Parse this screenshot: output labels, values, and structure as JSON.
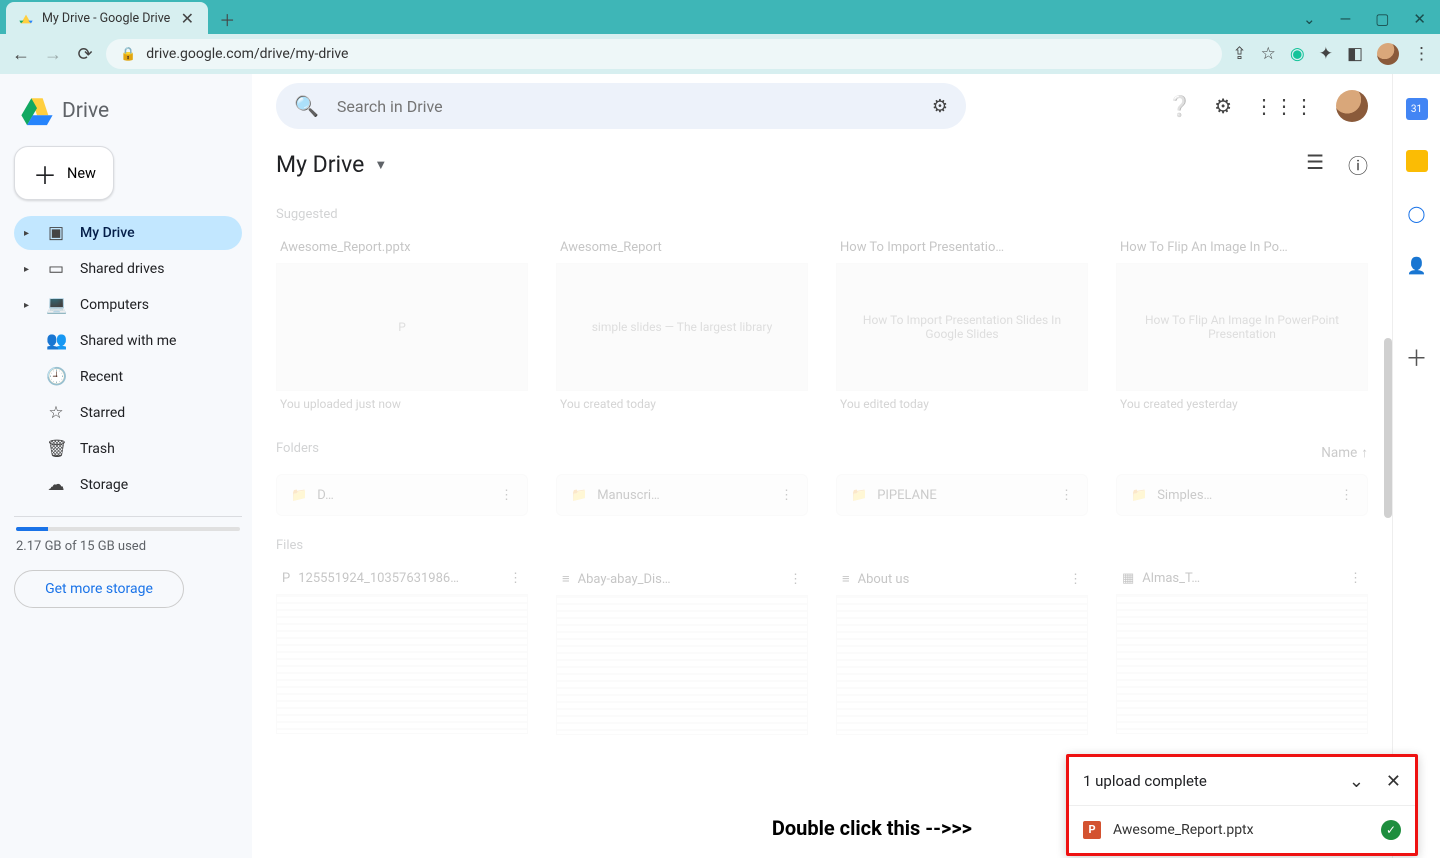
{
  "browser": {
    "tab_title": "My Drive - Google Drive",
    "url": "drive.google.com/drive/my-drive"
  },
  "product": {
    "name": "Drive"
  },
  "search": {
    "placeholder": "Search in Drive"
  },
  "new_button": "New",
  "sidebar": {
    "items": [
      {
        "label": "My Drive",
        "icon": "▣",
        "caret": true,
        "active": true
      },
      {
        "label": "Shared drives",
        "icon": "▭",
        "caret": true,
        "active": false
      },
      {
        "label": "Computers",
        "icon": "💻",
        "caret": true,
        "active": false
      },
      {
        "label": "Shared with me",
        "icon": "👥",
        "caret": false,
        "active": false
      },
      {
        "label": "Recent",
        "icon": "🕘",
        "caret": false,
        "active": false
      },
      {
        "label": "Starred",
        "icon": "☆",
        "caret": false,
        "active": false
      },
      {
        "label": "Trash",
        "icon": "🗑",
        "caret": false,
        "active": false
      },
      {
        "label": "Storage",
        "icon": "☁",
        "caret": false,
        "active": false
      }
    ],
    "storage_used": "2.17 GB of 15 GB used",
    "get_more": "Get more storage"
  },
  "main": {
    "heading": "My Drive",
    "suggested_label": "Suggested",
    "suggested": [
      {
        "title": "Awesome_Report.pptx",
        "thumb": "P",
        "sub": "You uploaded just now"
      },
      {
        "title": "Awesome_Report",
        "thumb": "simple slides — The largest library",
        "sub": "You created today"
      },
      {
        "title": "How To Import Presentatio…",
        "thumb": "How To Import Presentation Slides In Google Slides",
        "sub": "You edited today"
      },
      {
        "title": "How To Flip An Image In Po…",
        "thumb": "How To Flip An Image In PowerPoint Presentation",
        "sub": "You created yesterday"
      }
    ],
    "folders_label": "Folders",
    "name_sort": "Name",
    "folders": [
      {
        "label": "D…"
      },
      {
        "label": "Manuscri…"
      },
      {
        "label": "PIPELANE"
      },
      {
        "label": "Simples…"
      }
    ],
    "files_label": "Files",
    "files": [
      {
        "icon": "P",
        "title": "125551924_10357631986…"
      },
      {
        "icon": "≡",
        "title": "Abay-abay_Dis…"
      },
      {
        "icon": "≡",
        "title": "About us"
      },
      {
        "icon": "▦",
        "title": "Almas_T…"
      }
    ]
  },
  "annotation": "Double click this -->>>",
  "upload": {
    "header": "1 upload complete",
    "file": "Awesome_Report.pptx"
  }
}
